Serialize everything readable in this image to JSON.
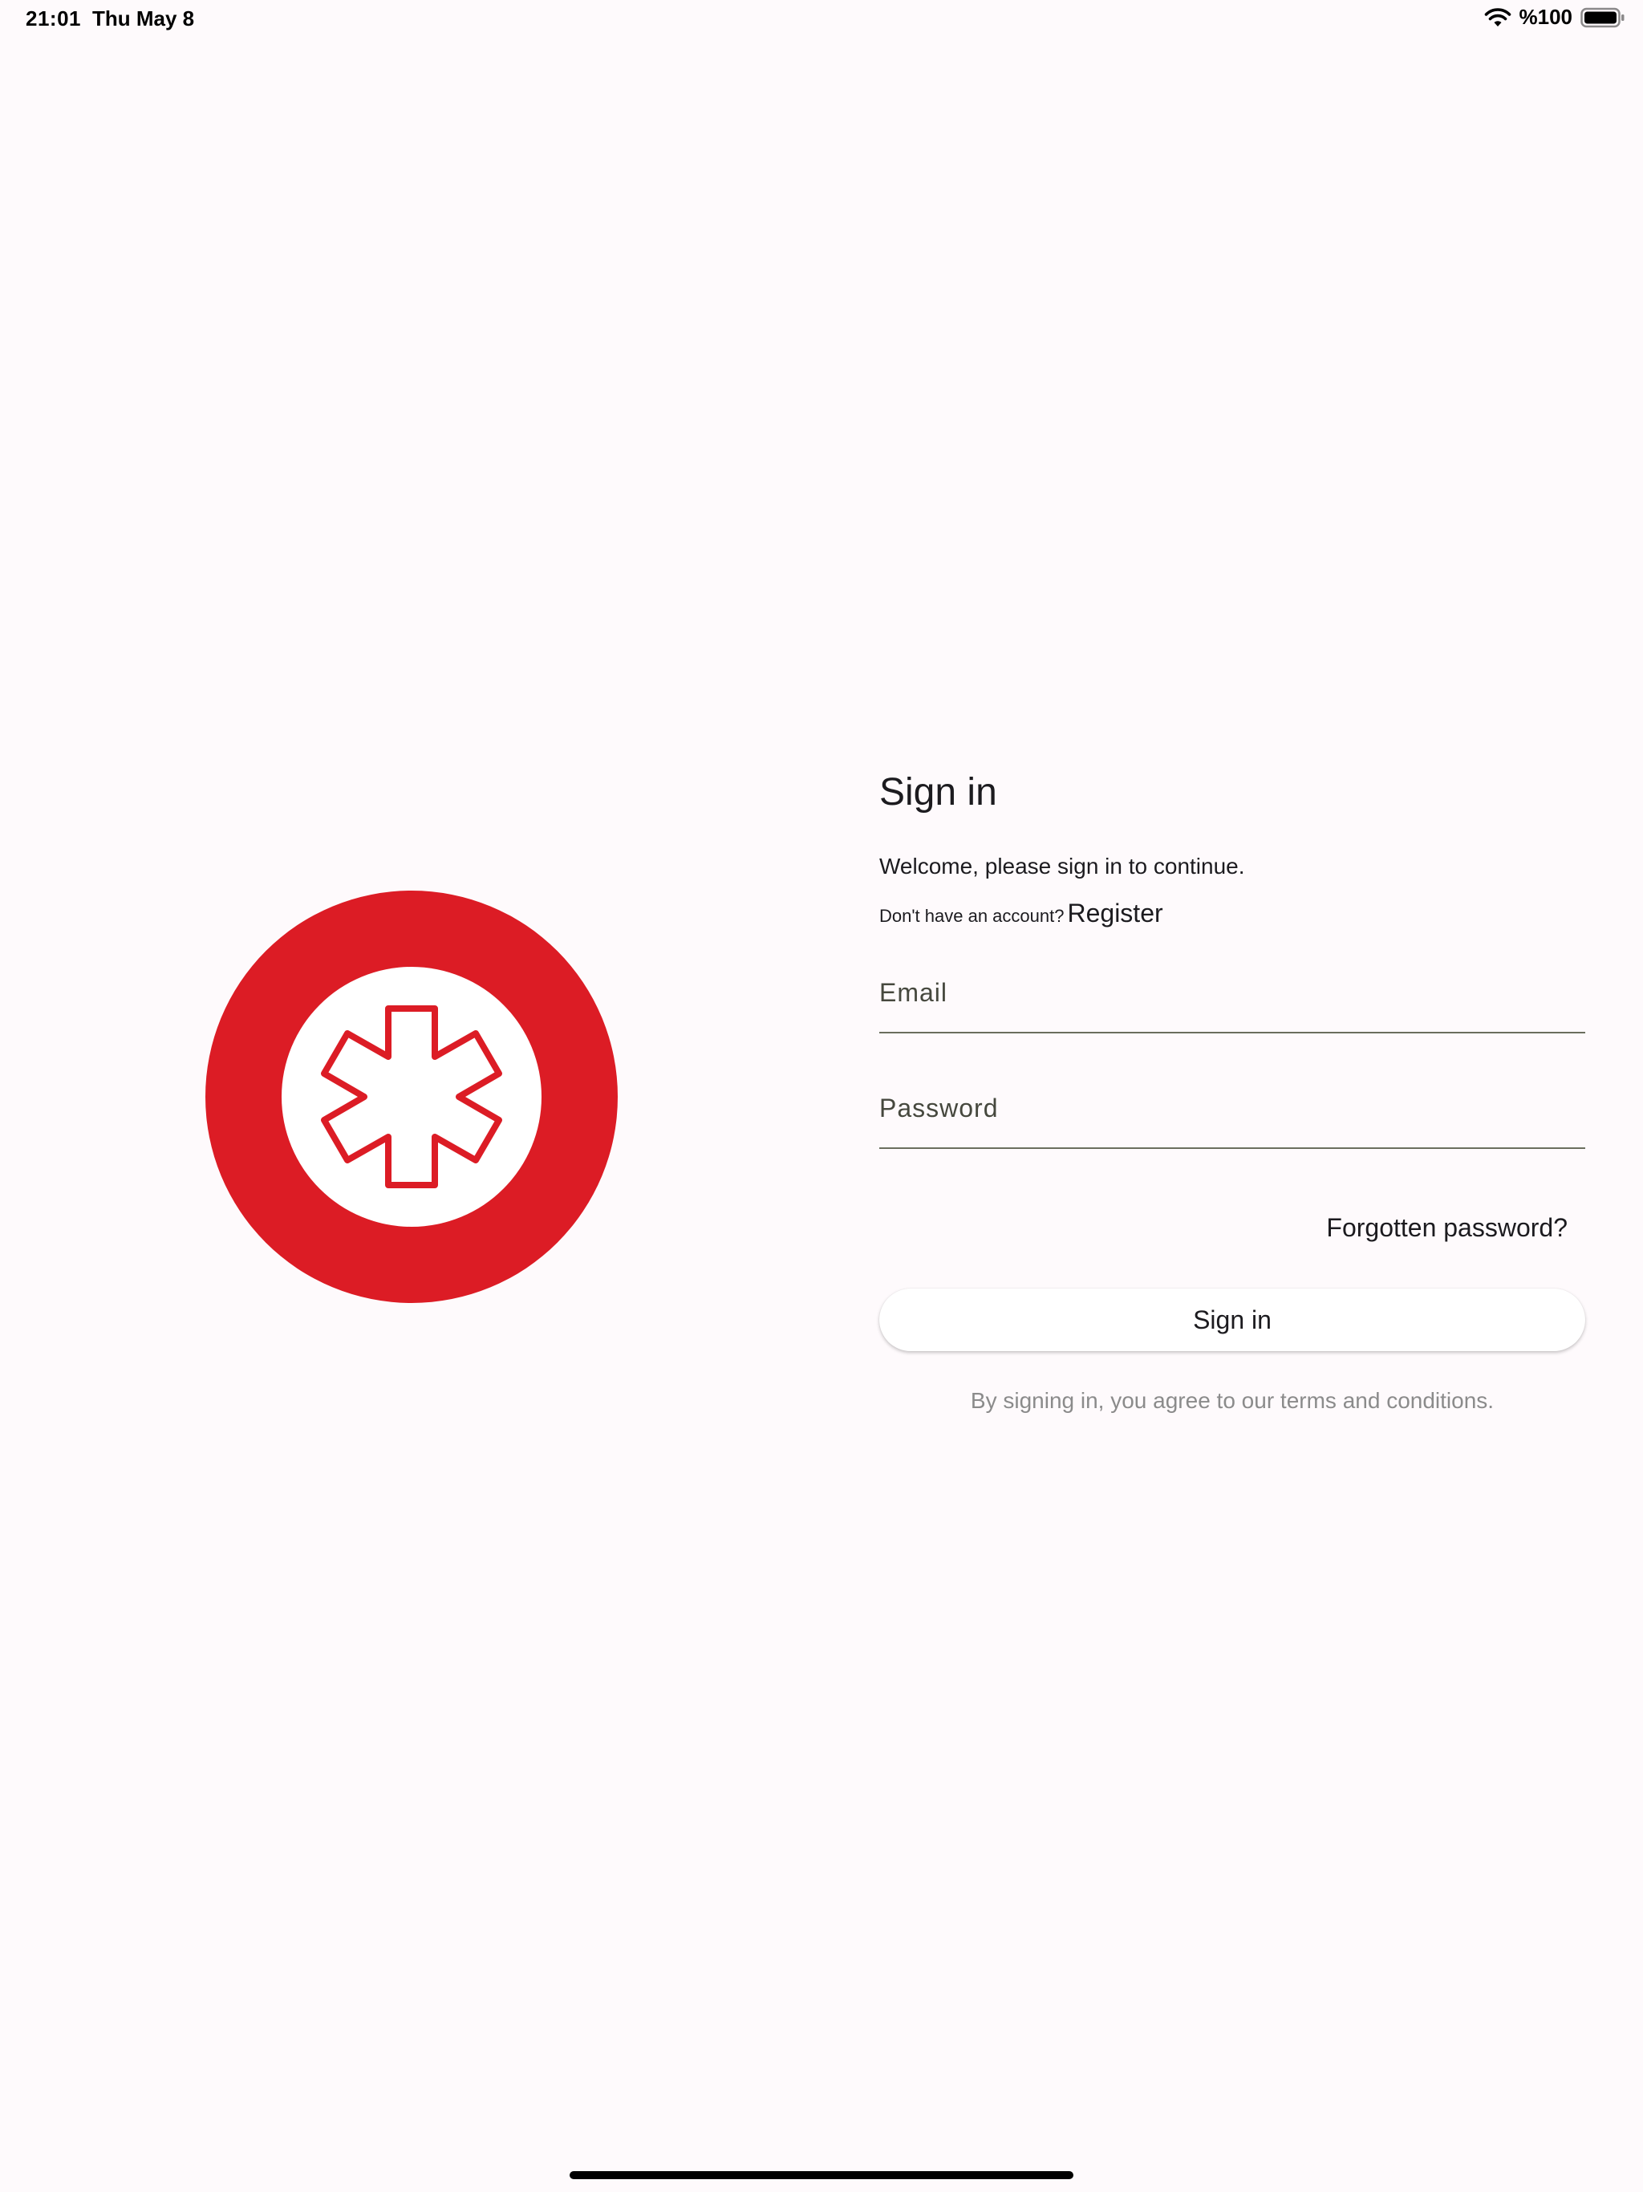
{
  "status_bar": {
    "time": "21:01",
    "date": "Thu May 8",
    "battery_percent": "%100",
    "battery_level": 1.0,
    "wifi_icon": "wifi-icon",
    "battery_icon": "battery-icon"
  },
  "logo": {
    "icon": "medical-star-icon",
    "ring_color": "#DC1C25",
    "inner_color": "#FFFFFF"
  },
  "form": {
    "title": "Sign in",
    "welcome": "Welcome, please sign in to continue.",
    "account_question": "Don't have an account?",
    "register_label": "Register",
    "email": {
      "placeholder": "Email",
      "value": ""
    },
    "password": {
      "placeholder": "Password",
      "value": ""
    },
    "forgot_label": "Forgotten password?",
    "signin_label": "Sign in",
    "terms": "By signing in, you agree to our terms and conditions."
  },
  "colors": {
    "background": "#FEFAFC",
    "accent_red": "#DC1C25",
    "underline": "#6B6E5E",
    "muted_text": "#8B8B8B"
  }
}
